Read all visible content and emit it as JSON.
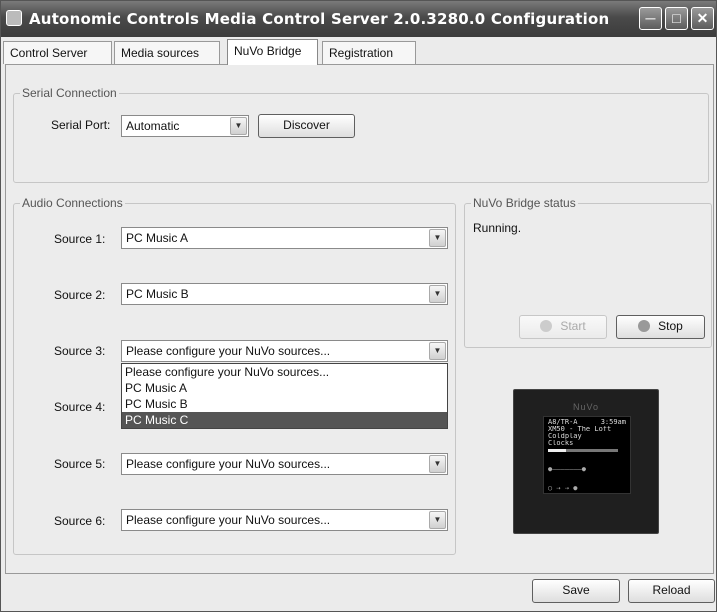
{
  "window": {
    "title": "Autonomic Controls Media Control Server 2.0.3280.0 Configuration"
  },
  "tabs": [
    {
      "label": "Control Server",
      "active": false
    },
    {
      "label": "Media sources",
      "active": false
    },
    {
      "label": "NuVo Bridge",
      "active": true
    },
    {
      "label": "Registration",
      "active": false
    }
  ],
  "serial": {
    "legend": "Serial Connection",
    "port_label": "Serial Port:",
    "port_value": "Automatic",
    "discover_label": "Discover"
  },
  "audio": {
    "legend": "Audio Connections",
    "sources": [
      {
        "label": "Source 1:",
        "value": "PC Music A"
      },
      {
        "label": "Source 2:",
        "value": "PC Music B"
      },
      {
        "label": "Source 3:",
        "value": "Please configure your NuVo sources..."
      },
      {
        "label": "Source 4:",
        "value": ""
      },
      {
        "label": "Source 5:",
        "value": "Please configure your NuVo sources..."
      },
      {
        "label": "Source 6:",
        "value": "Please configure your NuVo sources..."
      }
    ],
    "dropdown_options": [
      {
        "label": "Please configure your NuVo sources...",
        "selected": false
      },
      {
        "label": "PC Music A",
        "selected": false
      },
      {
        "label": "PC Music B",
        "selected": false
      },
      {
        "label": "PC Music C",
        "selected": true
      }
    ]
  },
  "status": {
    "legend": "NuVo Bridge status",
    "text": "Running.",
    "start_label": "Start",
    "start_enabled": false,
    "stop_label": "Stop",
    "stop_enabled": true
  },
  "device": {
    "brand": "NuVo",
    "header_left": "A8/TR-A",
    "header_right": "3:59am",
    "line1": "XM50 - The Loft",
    "line2": "Coldplay",
    "line3": "Clocks",
    "progress": 0.25
  },
  "footer": {
    "save_label": "Save",
    "reload_label": "Reload"
  }
}
